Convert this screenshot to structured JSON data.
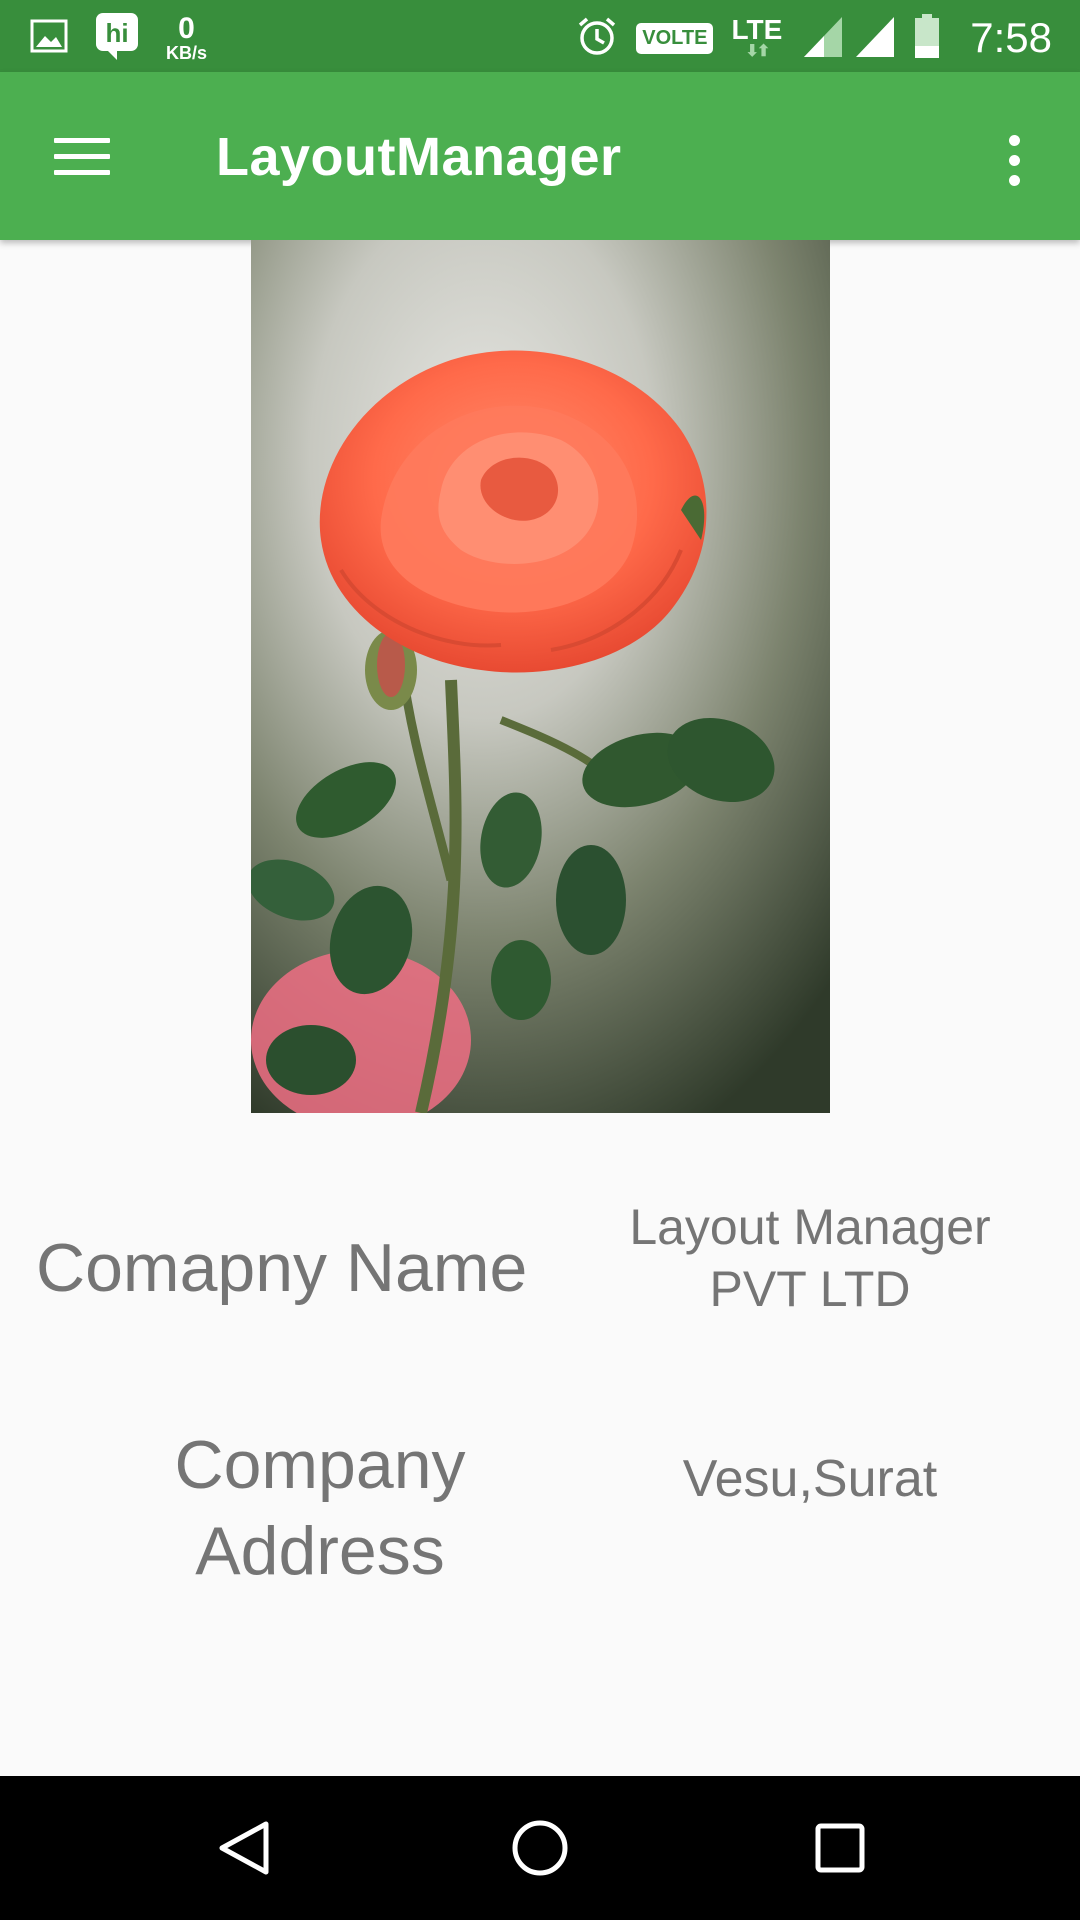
{
  "status_bar": {
    "net_speed_value": "0",
    "net_speed_unit": "KB/s",
    "volte_label": "VOLTE",
    "network_label": "LTE",
    "time": "7:58",
    "left_icons": [
      "gallery-icon",
      "hike-hi-icon"
    ],
    "right_icons": [
      "alarm-icon",
      "signal-icon",
      "battery-icon"
    ]
  },
  "app_bar": {
    "title": "LayoutManager",
    "background": "#4caf50",
    "status_background": "#388e3c"
  },
  "image": {
    "subject": "orange-rose-photo"
  },
  "details": {
    "company_name_label": "Comapny Name",
    "company_name_value_line1": "Layout Manager",
    "company_name_value_line2": "PVT LTD",
    "company_address_label_line1": "Company",
    "company_address_label_line2": "Address",
    "company_address_value": "Vesu,Surat",
    "text_color": "#757575"
  },
  "nav_bar": {
    "icons": [
      "back-icon",
      "home-icon",
      "recents-icon"
    ]
  }
}
